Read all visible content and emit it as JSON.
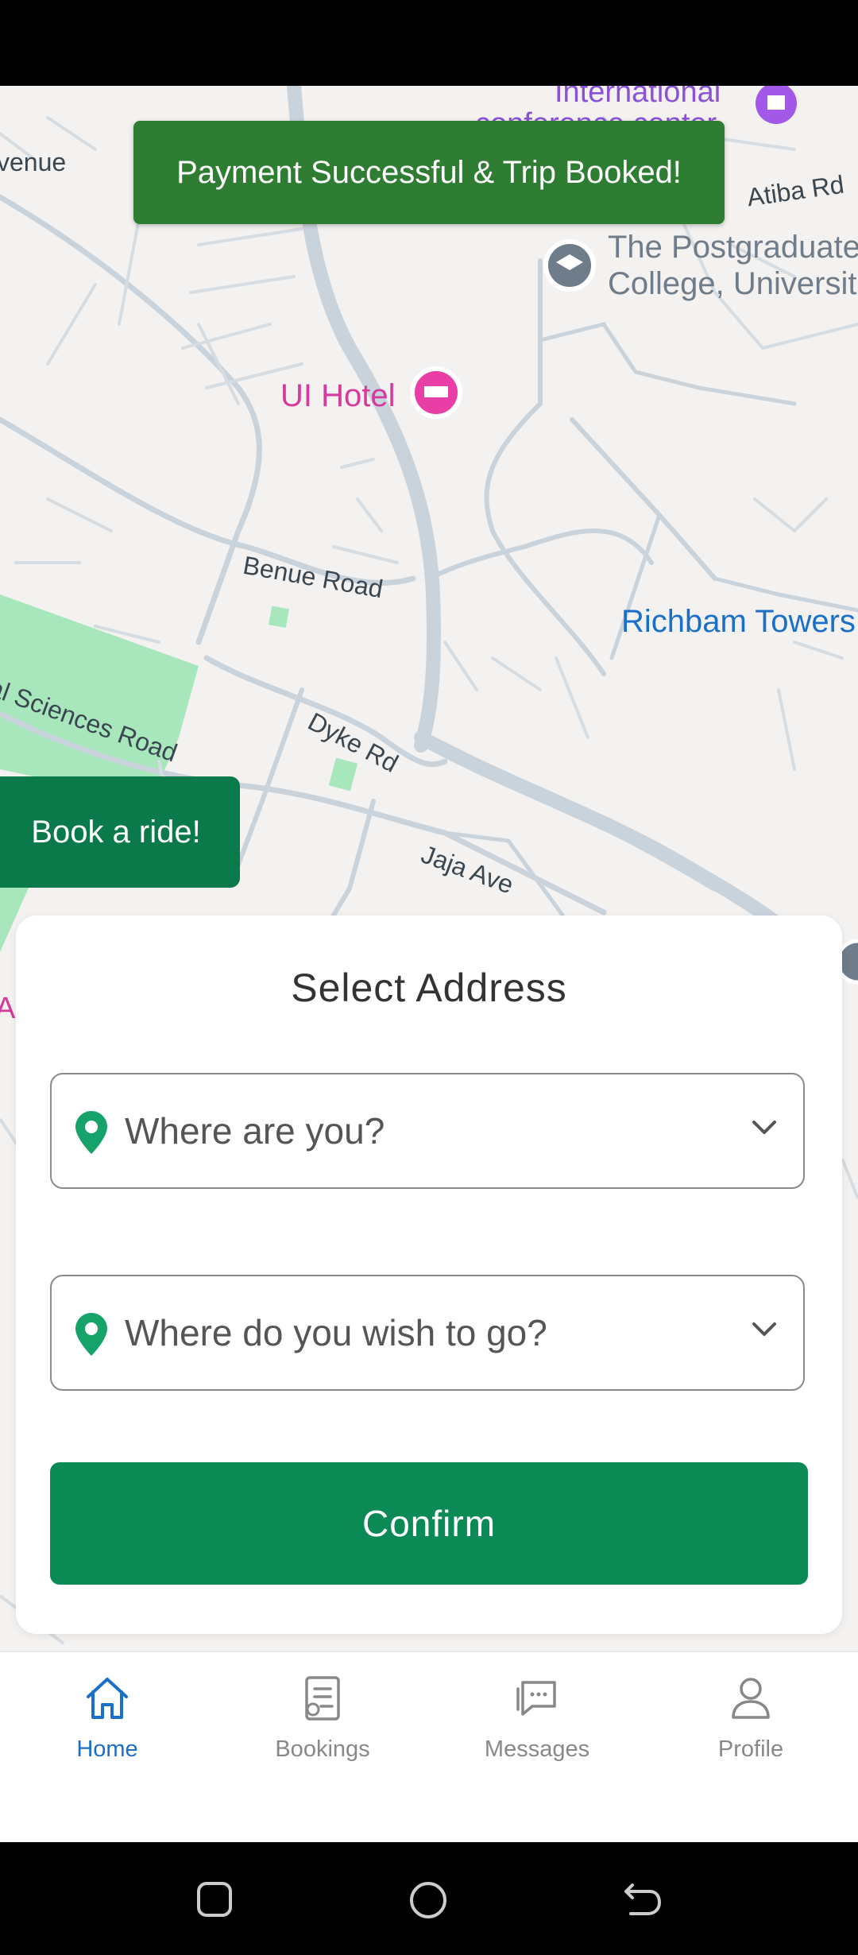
{
  "toast": {
    "message": "Payment Successful & Trip Booked!"
  },
  "map": {
    "labels": {
      "venue": "venue",
      "conference_line1": "International",
      "conference_line2": "conference center",
      "atiba": "Atiba Rd",
      "postgrad_line1": "The Postgraduate",
      "postgrad_line2": "College, Universit",
      "ui_hotel": "UI Hotel",
      "benue": "Benue Road",
      "richbam": "Richbam Towers",
      "sciences": "al Sciences Road",
      "dyke": "Dyke Rd",
      "jaja": "Jaja Ave",
      "az": "Az"
    }
  },
  "book_ride": {
    "label": "Book a ride!"
  },
  "address_card": {
    "title": "Select Address",
    "origin": {
      "placeholder": "Where are you?"
    },
    "destination": {
      "placeholder": "Where do you wish to go?"
    },
    "confirm_label": "Confirm"
  },
  "tabs": [
    {
      "label": "Home",
      "icon": "home-icon",
      "active": true
    },
    {
      "label": "Bookings",
      "icon": "bookings-icon",
      "active": false
    },
    {
      "label": "Messages",
      "icon": "messages-icon",
      "active": false
    },
    {
      "label": "Profile",
      "icon": "profile-icon",
      "active": false
    }
  ],
  "colors": {
    "toast_bg": "#2e7d32",
    "primary_green": "#0b8a56",
    "active_tab": "#1a6fc9",
    "pin_green": "#16a36a"
  }
}
